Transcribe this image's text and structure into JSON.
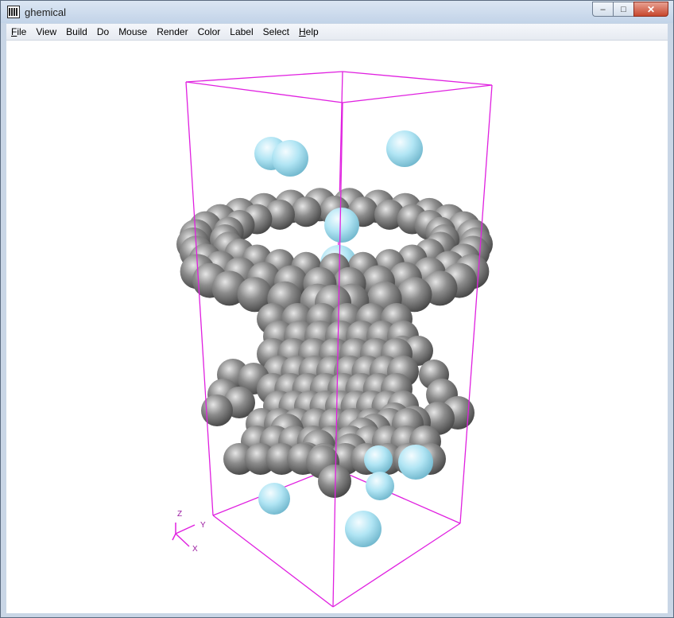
{
  "window": {
    "title": "ghemical",
    "controls": {
      "minimize": "–",
      "maximize": "□",
      "close": "✕"
    }
  },
  "menu": [
    {
      "label": "File",
      "mnemonic": "F",
      "rest": "ile"
    },
    {
      "label": "View",
      "mnemonic": "",
      "rest": "View"
    },
    {
      "label": "Build",
      "mnemonic": "",
      "rest": "Build"
    },
    {
      "label": "Do",
      "mnemonic": "",
      "rest": "Do"
    },
    {
      "label": "Mouse",
      "mnemonic": "",
      "rest": "Mouse"
    },
    {
      "label": "Render",
      "mnemonic": "",
      "rest": "Render"
    },
    {
      "label": "Color",
      "mnemonic": "",
      "rest": "Color"
    },
    {
      "label": "Label",
      "mnemonic": "",
      "rest": "Label"
    },
    {
      "label": "Select",
      "mnemonic": "",
      "rest": "Select"
    },
    {
      "label": "Help",
      "mnemonic": "H",
      "rest": "elp"
    }
  ],
  "scene": {
    "axes": {
      "x": "X",
      "y": "Y",
      "z": "Z"
    },
    "colors": {
      "box": "#e020e0",
      "carbon": "#7a7a7a",
      "water": "#a9e3f2",
      "axes": "#e020e0"
    }
  }
}
